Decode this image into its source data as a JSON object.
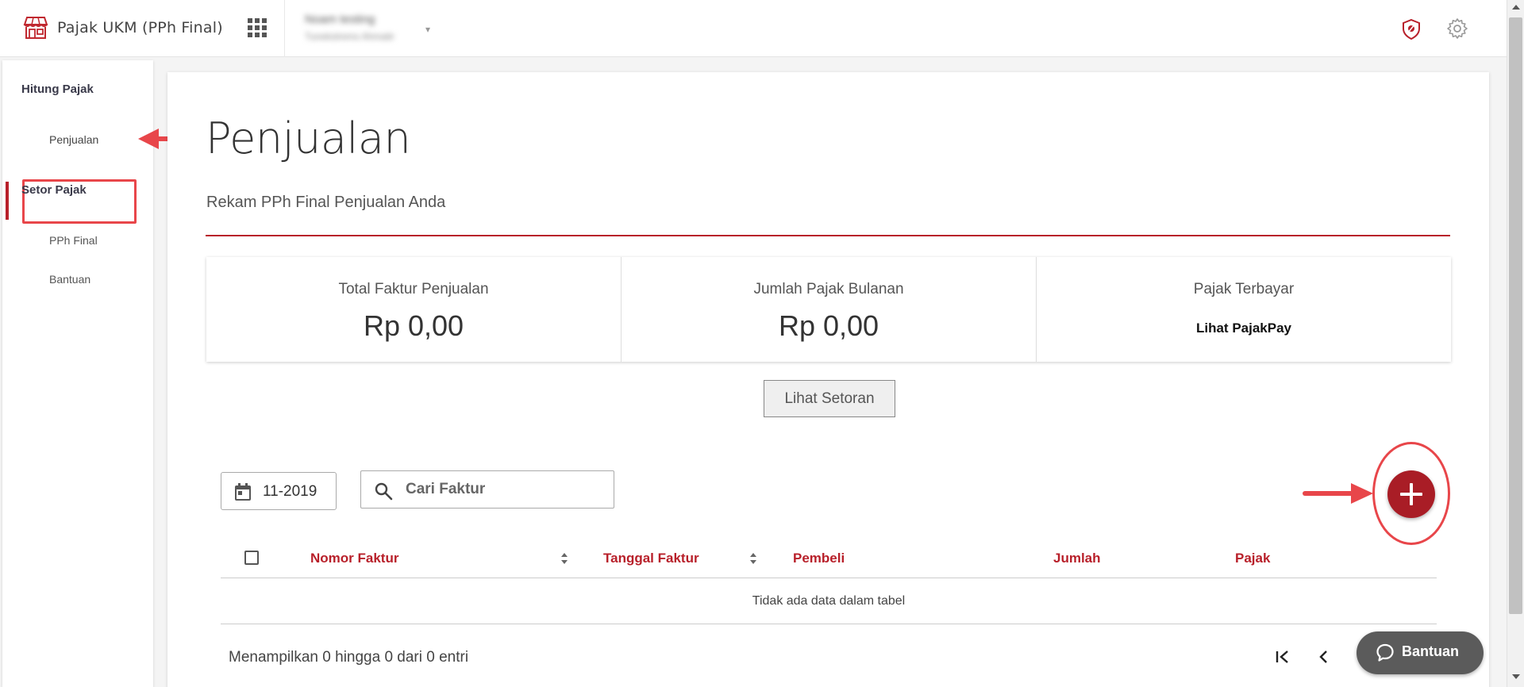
{
  "header": {
    "app_title": "Pajak UKM (PPh Final)",
    "user_name": "Noam testing",
    "user_sub": "Tunekstrems Ahmatir",
    "caret": "▾"
  },
  "sidebar": {
    "sections": [
      {
        "label": "Hitung Pajak",
        "items": [
          {
            "label": "Penjualan",
            "active": true
          }
        ]
      },
      {
        "label": "Setor Pajak",
        "items": [
          {
            "label": "PPh Final"
          },
          {
            "label": "Bantuan"
          }
        ]
      }
    ]
  },
  "page": {
    "title": "Penjualan",
    "subtitle": "Rekam PPh Final Penjualan Anda"
  },
  "stats": [
    {
      "label": "Total Faktur Penjualan",
      "value": "Rp 0,00"
    },
    {
      "label": "Jumlah Pajak Bulanan",
      "value": "Rp 0,00"
    },
    {
      "label": "Pajak Terbayar",
      "link": "Lihat PajakPay"
    }
  ],
  "buttons": {
    "lihat_setoran": "Lihat Setoran",
    "bantuan": "Bantuan"
  },
  "filters": {
    "period": "11-2019",
    "search_placeholder": "Cari Faktur"
  },
  "table": {
    "columns": [
      "Nomor Faktur",
      "Tanggal Faktur",
      "Pembeli",
      "Jumlah",
      "Pajak"
    ],
    "empty_message": "Tidak ada data dalam tabel",
    "info": "Menampilkan 0 hingga 0 dari 0 entri"
  },
  "colors": {
    "brand_red": "#b8202a",
    "annotation_red": "#e8464a",
    "fab_red": "#a91d26"
  }
}
